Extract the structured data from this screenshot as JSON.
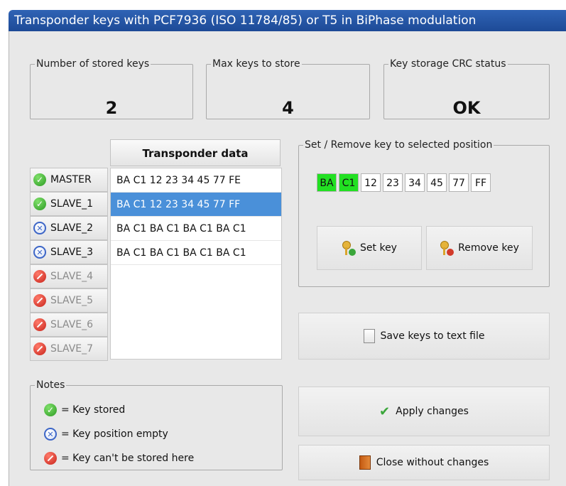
{
  "window": {
    "title": "Transponder keys with PCF7936 (ISO 11784/85) or T5 in BiPhase modulation"
  },
  "stats": [
    {
      "label": "Number of stored keys",
      "value": "2"
    },
    {
      "label": "Max keys to store",
      "value": "4"
    },
    {
      "label": "Key storage CRC status",
      "value": "OK"
    }
  ],
  "slots": [
    {
      "label": "MASTER",
      "status": "stored"
    },
    {
      "label": "SLAVE_1",
      "status": "stored"
    },
    {
      "label": "SLAVE_2",
      "status": "empty"
    },
    {
      "label": "SLAVE_3",
      "status": "empty"
    },
    {
      "label": "SLAVE_4",
      "status": "blocked"
    },
    {
      "label": "SLAVE_5",
      "status": "blocked"
    },
    {
      "label": "SLAVE_6",
      "status": "blocked"
    },
    {
      "label": "SLAVE_7",
      "status": "blocked"
    }
  ],
  "data_table": {
    "header": "Transponder data",
    "rows": [
      "BA C1 12 23 34 45 77 FE",
      "BA C1 12 23 34 45 77 FF",
      "BA C1 BA C1 BA C1 BA C1",
      "BA C1 BA C1 BA C1 BA C1"
    ],
    "selected_index": 1
  },
  "setkey": {
    "legend": "Set / Remove key to selected position",
    "bytes": [
      "BA",
      "C1",
      "12",
      "23",
      "34",
      "45",
      "77",
      "FF"
    ],
    "highlighted": [
      0,
      1
    ],
    "set_label": "Set key",
    "remove_label": "Remove key"
  },
  "buttons": {
    "save_label": "Save keys to text file",
    "apply_label": "Apply changes",
    "close_label": "Close without changes"
  },
  "notes": {
    "legend": "Notes",
    "stored": "= Key stored",
    "empty": "= Key position empty",
    "blocked": "= Key can't be stored here"
  },
  "colors": {
    "title_bar": "#1d4a97",
    "selected_row": "#4a90d9",
    "byte_highlight": "#22e022"
  }
}
